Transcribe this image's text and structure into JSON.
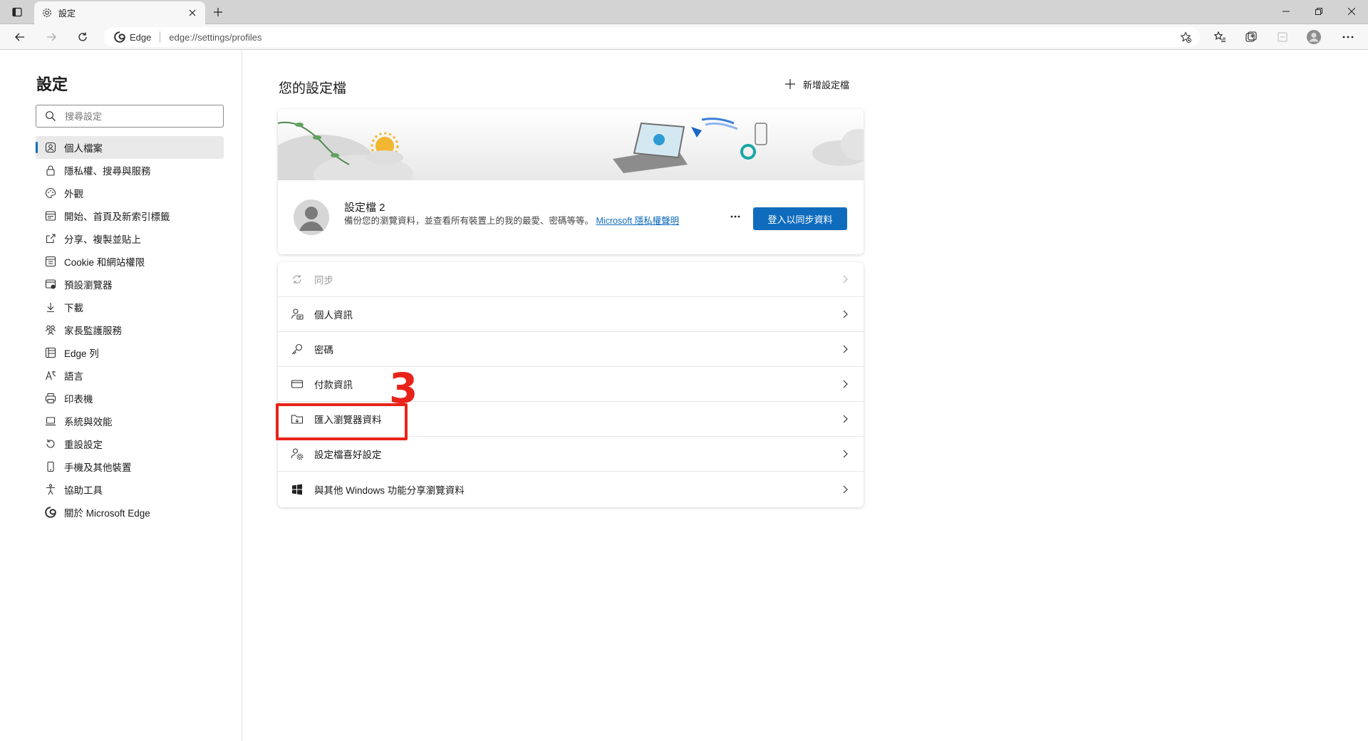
{
  "tab": {
    "title": "設定"
  },
  "address": {
    "site": "Edge",
    "url": "edge://settings/profiles"
  },
  "sidebar": {
    "title": "設定",
    "search_placeholder": "搜尋設定",
    "items": [
      {
        "label": "個人檔案",
        "icon": "profile-icon",
        "active": true
      },
      {
        "label": "隱私權、搜尋與服務",
        "icon": "lock-icon"
      },
      {
        "label": "外觀",
        "icon": "appearance-icon"
      },
      {
        "label": "開始、首頁及新索引標籤",
        "icon": "start-page-icon"
      },
      {
        "label": "分享、複製並貼上",
        "icon": "share-icon"
      },
      {
        "label": "Cookie 和網站權限",
        "icon": "site-permissions-icon"
      },
      {
        "label": "預設瀏覽器",
        "icon": "default-browser-icon"
      },
      {
        "label": "下載",
        "icon": "download-icon"
      },
      {
        "label": "家長監護服務",
        "icon": "family-icon"
      },
      {
        "label": "Edge 列",
        "icon": "edge-bar-icon"
      },
      {
        "label": "語言",
        "icon": "language-icon"
      },
      {
        "label": "印表機",
        "icon": "printer-icon"
      },
      {
        "label": "系統與效能",
        "icon": "system-icon"
      },
      {
        "label": "重設設定",
        "icon": "reset-icon"
      },
      {
        "label": "手機及其他裝置",
        "icon": "phone-icon"
      },
      {
        "label": "協助工具",
        "icon": "accessibility-icon"
      },
      {
        "label": "關於 Microsoft Edge",
        "icon": "edge-logo-icon"
      }
    ]
  },
  "main": {
    "title": "您的設定檔",
    "add_profile_label": "新增設定檔",
    "profile": {
      "name": "設定檔 2",
      "desc": "備份您的瀏覽資料，並查看所有裝置上的我的最愛、密碼等等。",
      "privacy_link": "Microsoft 隱私權聲明",
      "sync_button": "登入以同步資料"
    },
    "rows": [
      {
        "label": "同步",
        "icon": "sync-icon",
        "disabled": true
      },
      {
        "label": "個人資訊",
        "icon": "personal-info-icon"
      },
      {
        "label": "密碼",
        "icon": "key-icon"
      },
      {
        "label": "付款資訊",
        "icon": "credit-card-icon"
      },
      {
        "label": "匯入瀏覽器資料",
        "icon": "import-folder-icon"
      },
      {
        "label": "設定檔喜好設定",
        "icon": "profile-settings-icon"
      },
      {
        "label": "與其他 Windows 功能分享瀏覽資料",
        "icon": "windows-icon"
      }
    ]
  },
  "annotation": {
    "step": "3",
    "color": "#e8231a"
  },
  "colors": {
    "accent": "#0f6cbd"
  }
}
